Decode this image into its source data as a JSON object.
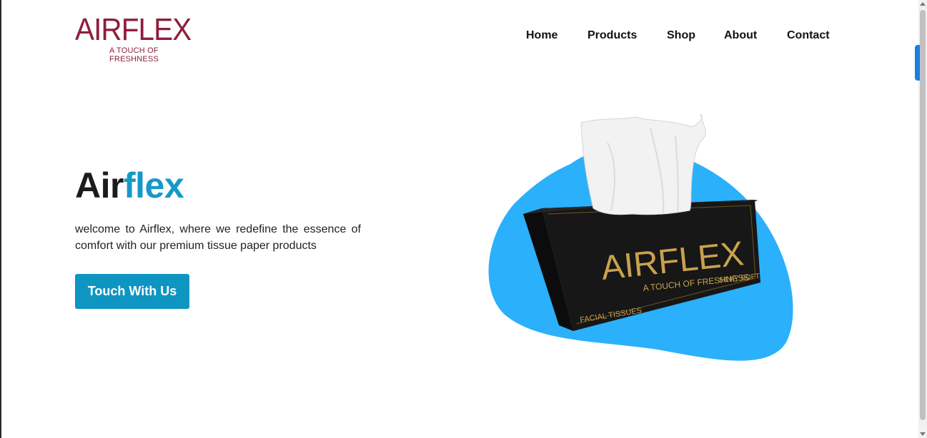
{
  "brand": {
    "logo_word": "AIRFLEX",
    "logo_tagline": "A TOUCH OF FRESHNESS",
    "color": "#8e1f3a"
  },
  "nav": {
    "items": [
      "Home",
      "Products",
      "Shop",
      "About",
      "Contact"
    ]
  },
  "hero": {
    "title_part1": "Air",
    "title_part2": "flex",
    "accent_color": "#1599c6",
    "description": "welcome to Airflex, where we redefine the essence of comfort with our premium tissue paper products",
    "cta_label": "Touch With Us",
    "cta_color": "#0e95c2",
    "product_image": {
      "box_brand": "AIRFLEX",
      "box_tagline": "A TOUCH OF FRESHNESS",
      "box_label_1": "SILKY SOFT",
      "box_label_2": "FACIAL TISSUES",
      "blob_color": "#2bb0fb",
      "box_color": "#151515",
      "gold_color": "#c9a24e"
    }
  }
}
